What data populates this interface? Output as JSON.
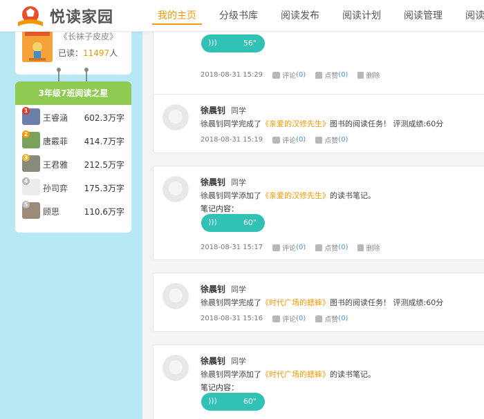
{
  "header": {
    "logo_text": "悦读家园",
    "nav": [
      "我的主页",
      "分级书库",
      "阅读发布",
      "阅读计划",
      "阅读管理",
      "阅读分析"
    ]
  },
  "sidebar": {
    "book": {
      "title": "《长袜子皮皮》",
      "read_label": "已读：",
      "read_count": "11497",
      "read_unit": "人"
    },
    "ranking": {
      "title": "3年级7班阅读之星",
      "items": [
        {
          "rank": "1",
          "name": "王睿涵",
          "value": "602.3万字"
        },
        {
          "rank": "2",
          "name": "唐霰菲",
          "value": "414.7万字"
        },
        {
          "rank": "3",
          "name": "王君雅",
          "value": "212.5万字"
        },
        {
          "rank": "4",
          "name": "孙司弈",
          "value": "175.3万字"
        },
        {
          "rank": "5",
          "name": "顾思",
          "value": "110.6万字"
        }
      ]
    }
  },
  "feed": {
    "comment_label": "评论",
    "like_label": "点赞",
    "delete_label": "删除",
    "posts": [
      {
        "audio_dur": "56\"",
        "time": "2018-08-31 15:29",
        "comments": "(0)",
        "likes": "(0)"
      },
      {
        "user": "徐晨钊",
        "role": "同学",
        "pre": "徐晨钊同学完成了",
        "book": "《亲爱的汉修先生》",
        "post": "图书的阅读任务！ 评测成绩:60分",
        "time": "2018-08-31 15:19",
        "comments": "(0)",
        "likes": "(0)"
      },
      {
        "user": "徐晨钊",
        "role": "同学",
        "pre": "徐晨钊同学添加了",
        "book": "《亲爱的汉修先生》",
        "post": "的读书笔记。",
        "note_label": "笔记内容：",
        "audio_dur": "60\"",
        "time": "2018-08-31 15:17",
        "comments": "(0)",
        "likes": "(0)"
      },
      {
        "user": "徐晨钊",
        "role": "同学",
        "pre": "徐晨钊同学完成了",
        "book": "《时代广场的蟋蟀》",
        "post": "图书的阅读任务！ 评测成绩:60分",
        "time": "2018-08-31 15:16",
        "comments": "(0)",
        "likes": "(0)"
      },
      {
        "user": "徐晨钊",
        "role": "同学",
        "pre": "徐晨钊同学添加了",
        "book": "《时代广场的蟋蟀》",
        "post": "的读书笔记。",
        "note_label": "笔记内容：",
        "audio_dur": "60\""
      }
    ]
  },
  "colors": {
    "accent": "#f39800",
    "audio": "#32c2b5",
    "ranking_header": "#8fcb52",
    "sidebar_bg": "#b7e8f3"
  }
}
